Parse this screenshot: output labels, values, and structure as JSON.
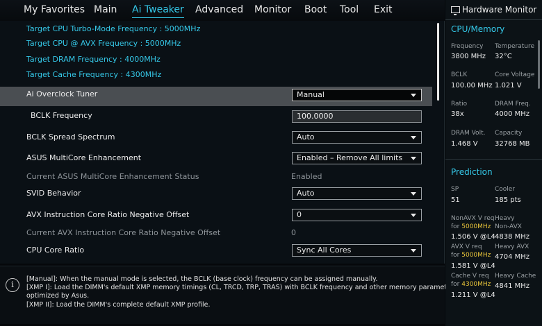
{
  "nav": {
    "tabs": [
      "My Favorites",
      "Main",
      "Ai Tweaker",
      "Advanced",
      "Monitor",
      "Boot",
      "Tool",
      "Exit"
    ],
    "active": "Ai Tweaker"
  },
  "targets": [
    "Target CPU Turbo-Mode Frequency : 5000MHz",
    "Target CPU @ AVX Frequency : 5000MHz",
    "Target DRAM Frequency : 4000MHz",
    "Target Cache Frequency : 4300MHz"
  ],
  "settings": {
    "ai_overclock_tuner": {
      "label": "Ai Overclock Tuner",
      "value": "Manual"
    },
    "bclk_frequency": {
      "label": "BCLK Frequency",
      "value": "100.0000"
    },
    "bclk_spread_spectrum": {
      "label": "BCLK Spread Spectrum",
      "value": "Auto"
    },
    "multicore_enhancement": {
      "label": "ASUS MultiCore Enhancement",
      "value": "Enabled – Remove All limits"
    },
    "multicore_status": {
      "label": "Current ASUS MultiCore Enhancement Status",
      "value": "Enabled"
    },
    "svid_behavior": {
      "label": "SVID Behavior",
      "value": "Auto"
    },
    "avx_offset": {
      "label": "AVX Instruction Core Ratio Negative Offset",
      "value": "0"
    },
    "avx_offset_current": {
      "label": "Current AVX Instruction Core Ratio Negative Offset",
      "value": "0"
    },
    "cpu_core_ratio": {
      "label": "CPU Core Ratio",
      "value": "Sync All Cores"
    }
  },
  "help": {
    "lines": [
      "[Manual]: When the manual mode is selected, the BCLK (base clock) frequency can be assigned manually.",
      "[XMP I]:  Load the DIMM's default XMP memory timings (CL, TRCD, TRP, TRAS) with BCLK frequency and other memory parameters",
      "optimized by Asus.",
      "[XMP II]:  Load the DIMM's complete default XMP profile."
    ]
  },
  "hw_monitor": {
    "title": "Hardware Monitor",
    "cpu_memory": {
      "heading": "CPU/Memory",
      "frequency": {
        "label": "Frequency",
        "value": "3800 MHz"
      },
      "temperature": {
        "label": "Temperature",
        "value": "32°C"
      },
      "bclk": {
        "label": "BCLK",
        "value": "100.00 MHz"
      },
      "core_voltage": {
        "label": "Core Voltage",
        "value": "1.021 V"
      },
      "ratio": {
        "label": "Ratio",
        "value": "38x"
      },
      "dram_freq": {
        "label": "DRAM Freq.",
        "value": "4000 MHz"
      },
      "dram_volt": {
        "label": "DRAM Volt.",
        "value": "1.468 V"
      },
      "capacity": {
        "label": "Capacity",
        "value": "32768 MB"
      }
    },
    "prediction": {
      "heading": "Prediction",
      "sp": {
        "label": "SP",
        "value": "51"
      },
      "cooler": {
        "label": "Cooler",
        "value": "185 pts"
      },
      "nonavx_req": {
        "label": "NonAVX V req",
        "for_text": "for",
        "freq": "5000MHz",
        "value": "1.506 V @L4"
      },
      "heavy_nonavx": {
        "label1": "Heavy",
        "label2": "Non-AVX",
        "value": "4838 MHz"
      },
      "avx_req": {
        "label": "AVX V req",
        "for_text": "for",
        "freq": "5000MHz",
        "value": "1.581 V @L4"
      },
      "heavy_avx": {
        "label": "Heavy AVX",
        "value": "4704 MHz"
      },
      "cache_req": {
        "label": "Cache V req",
        "for_text": "for",
        "freq": "4300MHz",
        "value": "1.211 V @L4"
      },
      "heavy_cache": {
        "label": "Heavy Cache",
        "value": "4841 MHz"
      }
    }
  },
  "colors": {
    "accent": "#35c8e8",
    "highlight": "#e8c43a",
    "selected_row": "#4a4e52"
  }
}
